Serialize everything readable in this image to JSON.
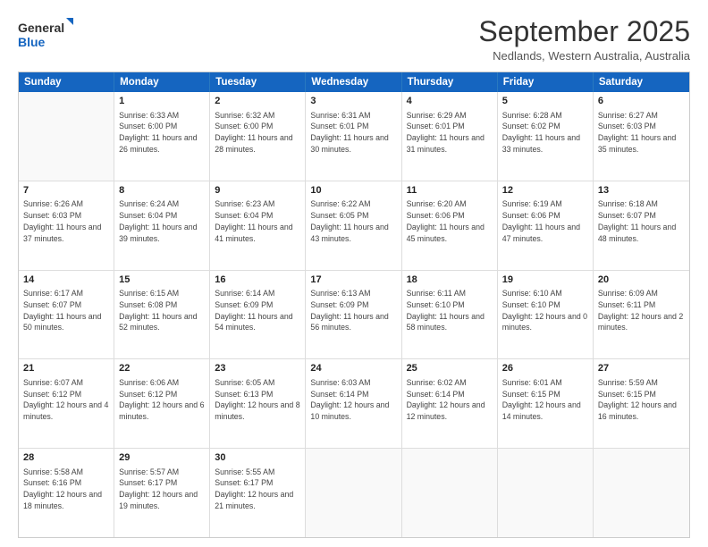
{
  "logo": {
    "line1": "General",
    "line2": "Blue"
  },
  "title": "September 2025",
  "subtitle": "Nedlands, Western Australia, Australia",
  "days": [
    "Sunday",
    "Monday",
    "Tuesday",
    "Wednesday",
    "Thursday",
    "Friday",
    "Saturday"
  ],
  "rows": [
    [
      {
        "day": "",
        "sunrise": "",
        "sunset": "",
        "daylight": ""
      },
      {
        "day": "1",
        "sunrise": "Sunrise: 6:33 AM",
        "sunset": "Sunset: 6:00 PM",
        "daylight": "Daylight: 11 hours and 26 minutes."
      },
      {
        "day": "2",
        "sunrise": "Sunrise: 6:32 AM",
        "sunset": "Sunset: 6:00 PM",
        "daylight": "Daylight: 11 hours and 28 minutes."
      },
      {
        "day": "3",
        "sunrise": "Sunrise: 6:31 AM",
        "sunset": "Sunset: 6:01 PM",
        "daylight": "Daylight: 11 hours and 30 minutes."
      },
      {
        "day": "4",
        "sunrise": "Sunrise: 6:29 AM",
        "sunset": "Sunset: 6:01 PM",
        "daylight": "Daylight: 11 hours and 31 minutes."
      },
      {
        "day": "5",
        "sunrise": "Sunrise: 6:28 AM",
        "sunset": "Sunset: 6:02 PM",
        "daylight": "Daylight: 11 hours and 33 minutes."
      },
      {
        "day": "6",
        "sunrise": "Sunrise: 6:27 AM",
        "sunset": "Sunset: 6:03 PM",
        "daylight": "Daylight: 11 hours and 35 minutes."
      }
    ],
    [
      {
        "day": "7",
        "sunrise": "Sunrise: 6:26 AM",
        "sunset": "Sunset: 6:03 PM",
        "daylight": "Daylight: 11 hours and 37 minutes."
      },
      {
        "day": "8",
        "sunrise": "Sunrise: 6:24 AM",
        "sunset": "Sunset: 6:04 PM",
        "daylight": "Daylight: 11 hours and 39 minutes."
      },
      {
        "day": "9",
        "sunrise": "Sunrise: 6:23 AM",
        "sunset": "Sunset: 6:04 PM",
        "daylight": "Daylight: 11 hours and 41 minutes."
      },
      {
        "day": "10",
        "sunrise": "Sunrise: 6:22 AM",
        "sunset": "Sunset: 6:05 PM",
        "daylight": "Daylight: 11 hours and 43 minutes."
      },
      {
        "day": "11",
        "sunrise": "Sunrise: 6:20 AM",
        "sunset": "Sunset: 6:06 PM",
        "daylight": "Daylight: 11 hours and 45 minutes."
      },
      {
        "day": "12",
        "sunrise": "Sunrise: 6:19 AM",
        "sunset": "Sunset: 6:06 PM",
        "daylight": "Daylight: 11 hours and 47 minutes."
      },
      {
        "day": "13",
        "sunrise": "Sunrise: 6:18 AM",
        "sunset": "Sunset: 6:07 PM",
        "daylight": "Daylight: 11 hours and 48 minutes."
      }
    ],
    [
      {
        "day": "14",
        "sunrise": "Sunrise: 6:17 AM",
        "sunset": "Sunset: 6:07 PM",
        "daylight": "Daylight: 11 hours and 50 minutes."
      },
      {
        "day": "15",
        "sunrise": "Sunrise: 6:15 AM",
        "sunset": "Sunset: 6:08 PM",
        "daylight": "Daylight: 11 hours and 52 minutes."
      },
      {
        "day": "16",
        "sunrise": "Sunrise: 6:14 AM",
        "sunset": "Sunset: 6:09 PM",
        "daylight": "Daylight: 11 hours and 54 minutes."
      },
      {
        "day": "17",
        "sunrise": "Sunrise: 6:13 AM",
        "sunset": "Sunset: 6:09 PM",
        "daylight": "Daylight: 11 hours and 56 minutes."
      },
      {
        "day": "18",
        "sunrise": "Sunrise: 6:11 AM",
        "sunset": "Sunset: 6:10 PM",
        "daylight": "Daylight: 11 hours and 58 minutes."
      },
      {
        "day": "19",
        "sunrise": "Sunrise: 6:10 AM",
        "sunset": "Sunset: 6:10 PM",
        "daylight": "Daylight: 12 hours and 0 minutes."
      },
      {
        "day": "20",
        "sunrise": "Sunrise: 6:09 AM",
        "sunset": "Sunset: 6:11 PM",
        "daylight": "Daylight: 12 hours and 2 minutes."
      }
    ],
    [
      {
        "day": "21",
        "sunrise": "Sunrise: 6:07 AM",
        "sunset": "Sunset: 6:12 PM",
        "daylight": "Daylight: 12 hours and 4 minutes."
      },
      {
        "day": "22",
        "sunrise": "Sunrise: 6:06 AM",
        "sunset": "Sunset: 6:12 PM",
        "daylight": "Daylight: 12 hours and 6 minutes."
      },
      {
        "day": "23",
        "sunrise": "Sunrise: 6:05 AM",
        "sunset": "Sunset: 6:13 PM",
        "daylight": "Daylight: 12 hours and 8 minutes."
      },
      {
        "day": "24",
        "sunrise": "Sunrise: 6:03 AM",
        "sunset": "Sunset: 6:14 PM",
        "daylight": "Daylight: 12 hours and 10 minutes."
      },
      {
        "day": "25",
        "sunrise": "Sunrise: 6:02 AM",
        "sunset": "Sunset: 6:14 PM",
        "daylight": "Daylight: 12 hours and 12 minutes."
      },
      {
        "day": "26",
        "sunrise": "Sunrise: 6:01 AM",
        "sunset": "Sunset: 6:15 PM",
        "daylight": "Daylight: 12 hours and 14 minutes."
      },
      {
        "day": "27",
        "sunrise": "Sunrise: 5:59 AM",
        "sunset": "Sunset: 6:15 PM",
        "daylight": "Daylight: 12 hours and 16 minutes."
      }
    ],
    [
      {
        "day": "28",
        "sunrise": "Sunrise: 5:58 AM",
        "sunset": "Sunset: 6:16 PM",
        "daylight": "Daylight: 12 hours and 18 minutes."
      },
      {
        "day": "29",
        "sunrise": "Sunrise: 5:57 AM",
        "sunset": "Sunset: 6:17 PM",
        "daylight": "Daylight: 12 hours and 19 minutes."
      },
      {
        "day": "30",
        "sunrise": "Sunrise: 5:55 AM",
        "sunset": "Sunset: 6:17 PM",
        "daylight": "Daylight: 12 hours and 21 minutes."
      },
      {
        "day": "",
        "sunrise": "",
        "sunset": "",
        "daylight": ""
      },
      {
        "day": "",
        "sunrise": "",
        "sunset": "",
        "daylight": ""
      },
      {
        "day": "",
        "sunrise": "",
        "sunset": "",
        "daylight": ""
      },
      {
        "day": "",
        "sunrise": "",
        "sunset": "",
        "daylight": ""
      }
    ]
  ]
}
